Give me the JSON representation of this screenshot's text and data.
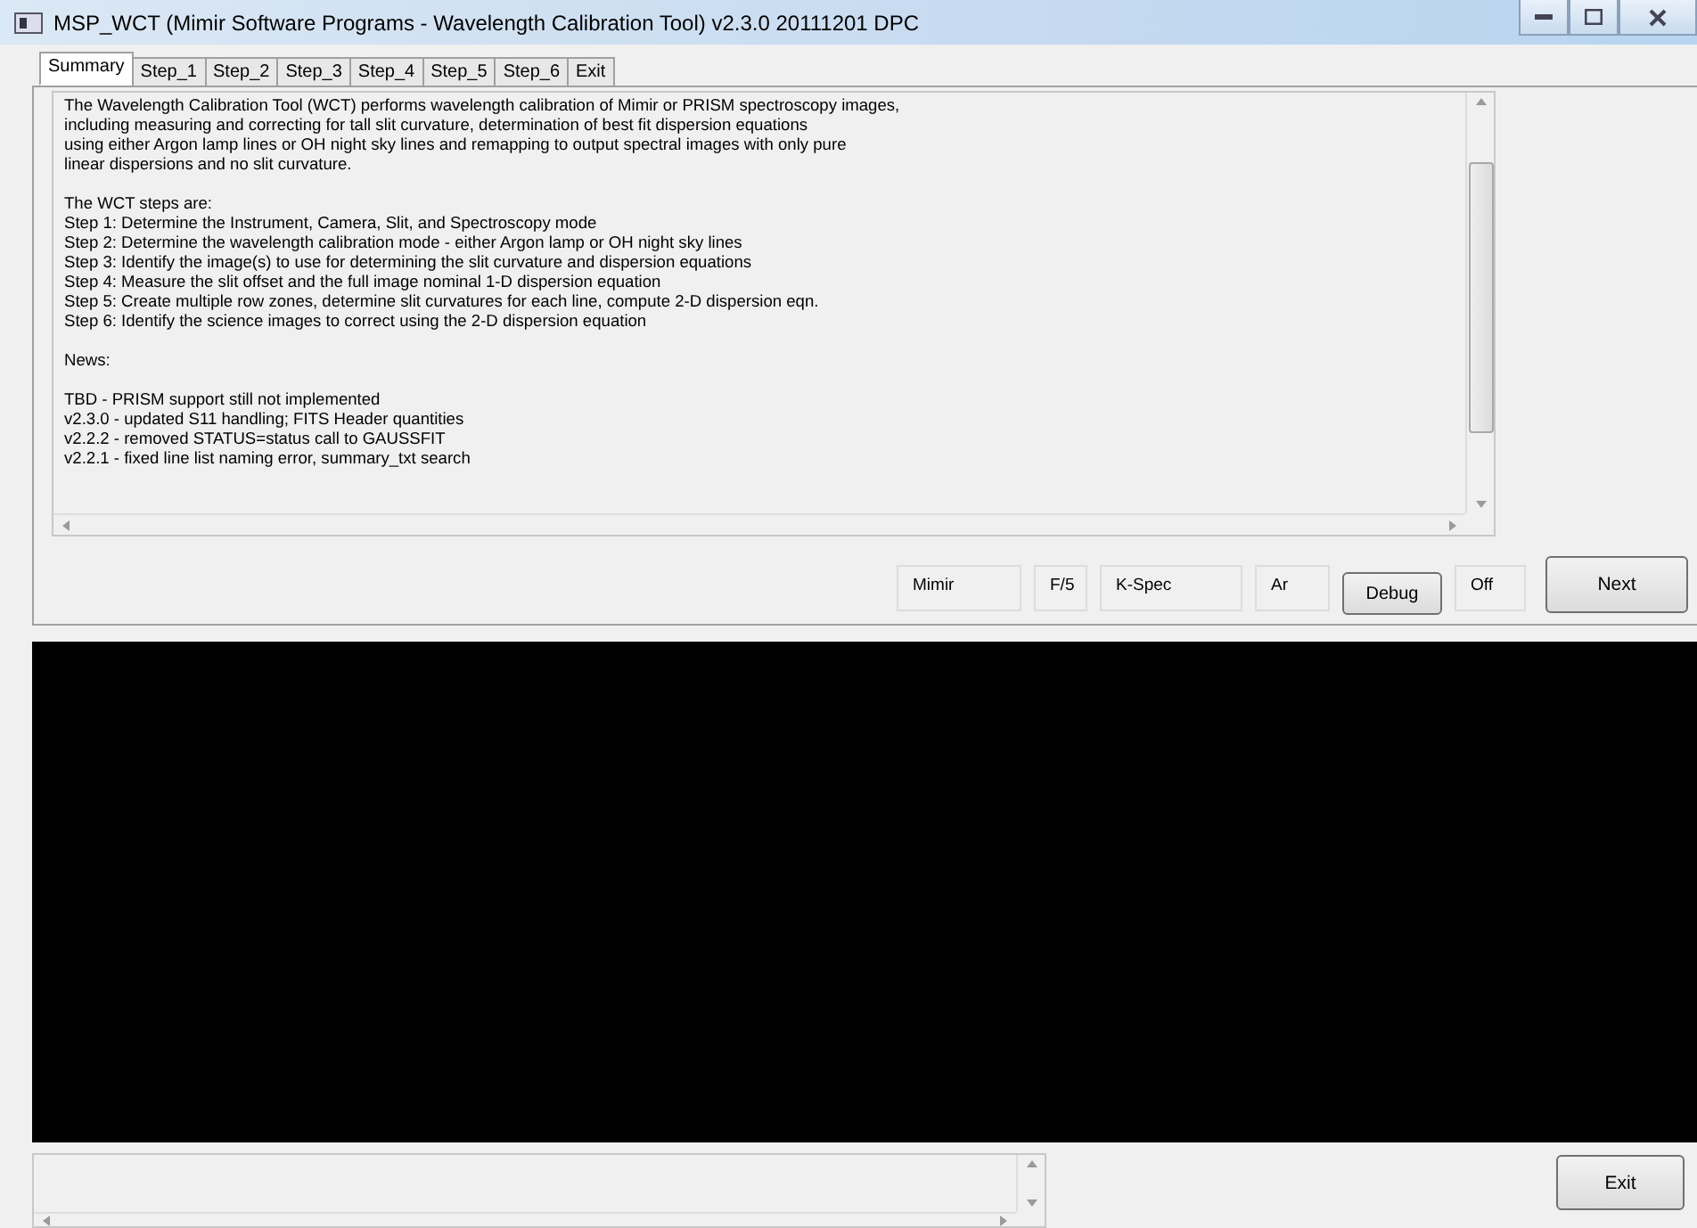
{
  "window": {
    "title": "MSP_WCT (Mimir Software Programs - Wavelength Calibration Tool) v2.3.0 20111201 DPC"
  },
  "tabs": [
    {
      "label": "Summary",
      "selected": true
    },
    {
      "label": "Step_1",
      "selected": false
    },
    {
      "label": "Step_2",
      "selected": false
    },
    {
      "label": "Step_3",
      "selected": false
    },
    {
      "label": "Step_4",
      "selected": false
    },
    {
      "label": "Step_5",
      "selected": false
    },
    {
      "label": "Step_6",
      "selected": false
    },
    {
      "label": "Exit",
      "selected": false
    }
  ],
  "summary": {
    "paragraphs": [
      [
        "The Wavelength Calibration Tool (WCT) performs wavelength calibration of Mimir or PRISM spectroscopy images,",
        "including measuring and correcting for tall slit curvature, determination of best fit dispersion equations",
        "using either Argon lamp lines or OH night sky lines and remapping to output spectral images with only pure",
        "linear dispersions and no slit curvature."
      ],
      [
        "The WCT steps are:",
        "Step 1: Determine the Instrument, Camera, Slit, and Spectroscopy mode",
        "Step 2: Determine the wavelength calibration mode - either Argon lamp or OH night sky lines",
        "Step 3: Identify the image(s) to use for determining the slit curvature and dispersion equations",
        "Step 4: Measure the slit offset and the full image nominal 1-D dispersion equation",
        "Step 5: Create multiple row zones, determine slit curvatures for each line, compute 2-D dispersion eqn.",
        "Step 6: Identify the science images to correct using the 2-D dispersion equation"
      ],
      [
        "News:"
      ],
      [
        "TBD - PRISM support still not implemented",
        "v2.3.0 - updated S11 handling; FITS Header quantities",
        "v2.2.2 - removed STATUS=status call to GAUSSFIT",
        "v2.2.1 - fixed line list naming error, summary_txt search"
      ]
    ]
  },
  "status_fields": [
    "Mimir",
    "F/5",
    "K-Spec",
    "Ar"
  ],
  "debug": {
    "button": "Debug",
    "state": "Off"
  },
  "next_button": "Next",
  "exit_button": "Exit"
}
